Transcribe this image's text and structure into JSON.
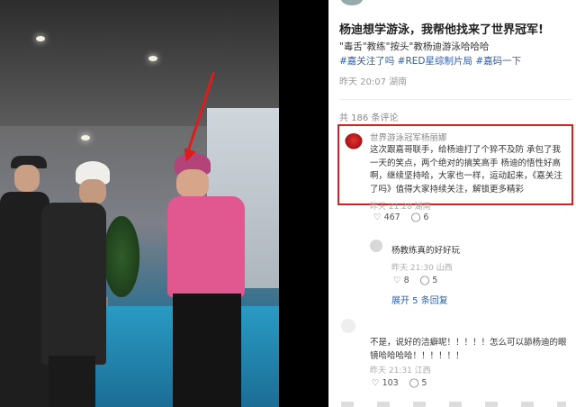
{
  "post": {
    "title": "杨迪想学游泳，我帮他找来了世界冠军!",
    "body_text": "\"毒舌\"教练\"按头\"教杨迪游泳哈哈哈",
    "tags": [
      "#嘉关注了吗",
      "#RED星综制片局",
      "#嘉码一下"
    ],
    "meta": "昨天 20:07 湖南",
    "comment_count": "共 186 条评论"
  },
  "comments": [
    {
      "user": "世界游泳冠军杨丽娜",
      "text": "这次跟嘉哥联手，给杨迪打了个猝不及防 承包了我一天的笑点，两个绝对的搞笑高手 杨迪的悟性好高啊，继续坚持哈，大家也一样，运动起来，《嘉关注了吗》值得大家持续关注，解锁更多精彩",
      "meta": "昨天 21:28 湖南",
      "likes": "467",
      "replies": "6"
    },
    {
      "user": "",
      "text": "杨教练真的好好玩",
      "meta": "昨天 21:30 山西",
      "likes": "8",
      "replies": "5",
      "expand": "展开 5 条回复"
    },
    {
      "user": "",
      "text": "不是，说好的洁癖呢！！！！！怎么可以舔杨迪的眼镜哈哈哈哈！！！！！！",
      "meta": "昨天 21:31 江西",
      "likes": "103",
      "replies": "5"
    }
  ],
  "icons": {
    "like": "heart-icon",
    "reply": "comment-icon"
  },
  "colors": {
    "highlight_border": "#d42020",
    "tag_link": "#2e5fa8",
    "annotation_arrow": "#e01b1b"
  }
}
